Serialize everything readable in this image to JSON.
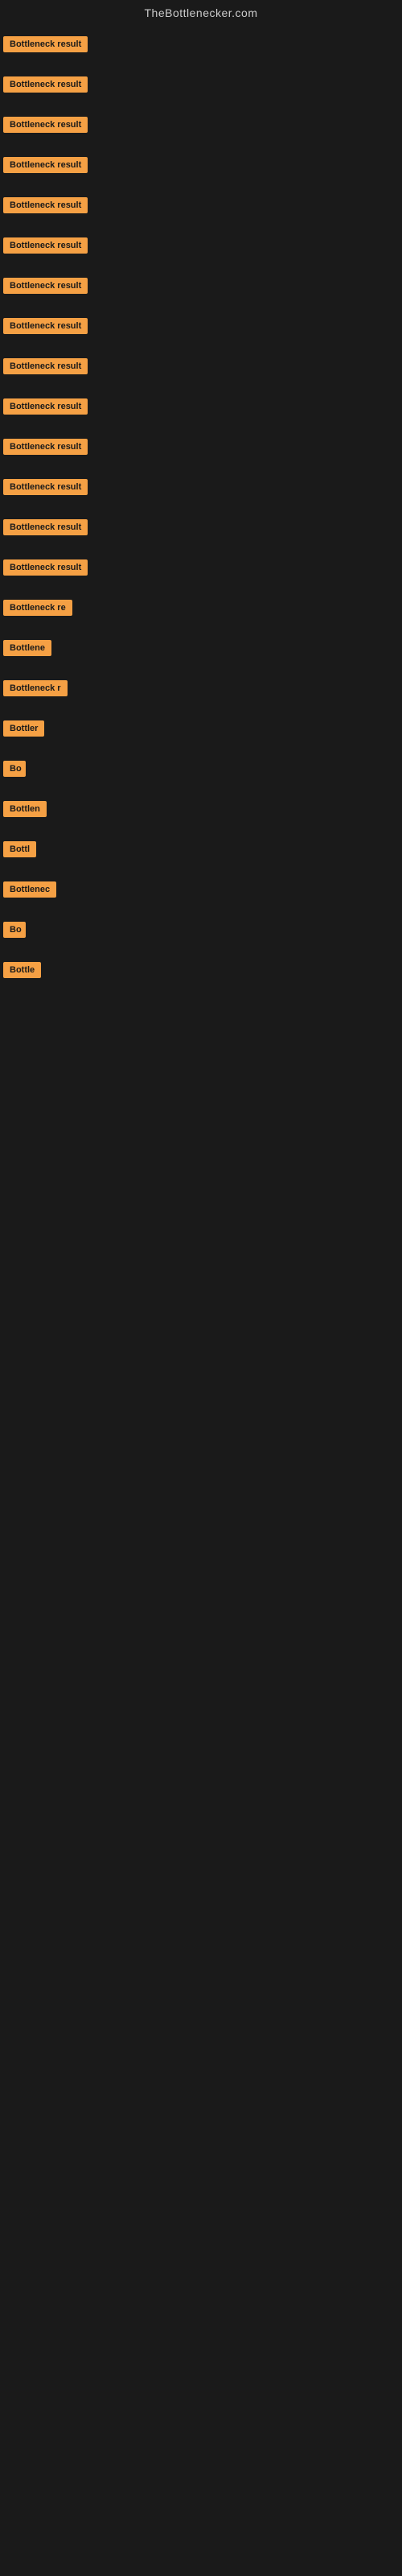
{
  "header": {
    "site_title": "TheBottlenecker.com"
  },
  "badges": [
    {
      "id": 1,
      "label": "Bottleneck result",
      "width": 120
    },
    {
      "id": 2,
      "label": "Bottleneck result",
      "width": 120
    },
    {
      "id": 3,
      "label": "Bottleneck result",
      "width": 120
    },
    {
      "id": 4,
      "label": "Bottleneck result",
      "width": 120
    },
    {
      "id": 5,
      "label": "Bottleneck result",
      "width": 120
    },
    {
      "id": 6,
      "label": "Bottleneck result",
      "width": 120
    },
    {
      "id": 7,
      "label": "Bottleneck result",
      "width": 120
    },
    {
      "id": 8,
      "label": "Bottleneck result",
      "width": 120
    },
    {
      "id": 9,
      "label": "Bottleneck result",
      "width": 120
    },
    {
      "id": 10,
      "label": "Bottleneck result",
      "width": 120
    },
    {
      "id": 11,
      "label": "Bottleneck result",
      "width": 120
    },
    {
      "id": 12,
      "label": "Bottleneck result",
      "width": 120
    },
    {
      "id": 13,
      "label": "Bottleneck result",
      "width": 120
    },
    {
      "id": 14,
      "label": "Bottleneck result",
      "width": 118
    },
    {
      "id": 15,
      "label": "Bottleneck re",
      "width": 90
    },
    {
      "id": 16,
      "label": "Bottlene",
      "width": 72
    },
    {
      "id": 17,
      "label": "Bottleneck r",
      "width": 86
    },
    {
      "id": 18,
      "label": "Bottler",
      "width": 58
    },
    {
      "id": 19,
      "label": "Bo",
      "width": 28
    },
    {
      "id": 20,
      "label": "Bottlen",
      "width": 66
    },
    {
      "id": 21,
      "label": "Bottl",
      "width": 50
    },
    {
      "id": 22,
      "label": "Bottlenec",
      "width": 78
    },
    {
      "id": 23,
      "label": "Bo",
      "width": 28
    },
    {
      "id": 24,
      "label": "Bottle",
      "width": 54
    }
  ],
  "colors": {
    "badge_bg": "#f5a044",
    "badge_text": "#1a1a1a",
    "page_bg": "#1a1a1a",
    "site_title": "#cccccc"
  }
}
